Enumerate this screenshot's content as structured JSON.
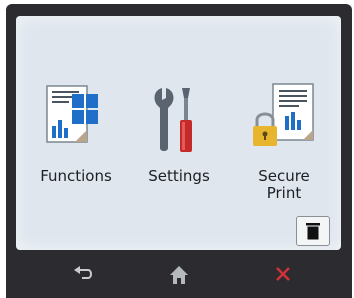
{
  "screen": {
    "tiles": [
      {
        "label": "Functions",
        "icon": "functions-icon"
      },
      {
        "label": "Settings",
        "icon": "settings-tools-icon"
      },
      {
        "label": "Secure\nPrint",
        "icon": "secure-print-icon"
      }
    ],
    "trash_icon": "trash-icon"
  },
  "navbar": {
    "back_icon": "back-arrow-icon",
    "home_icon": "home-icon",
    "cancel_icon": "cancel-x-icon"
  },
  "colors": {
    "screen_bg": "#dfe6ee",
    "bezel": "#2c2c30",
    "accent_blue": "#1f6fc8",
    "cancel_red": "#d2313a",
    "settings_red": "#c42a2a"
  }
}
